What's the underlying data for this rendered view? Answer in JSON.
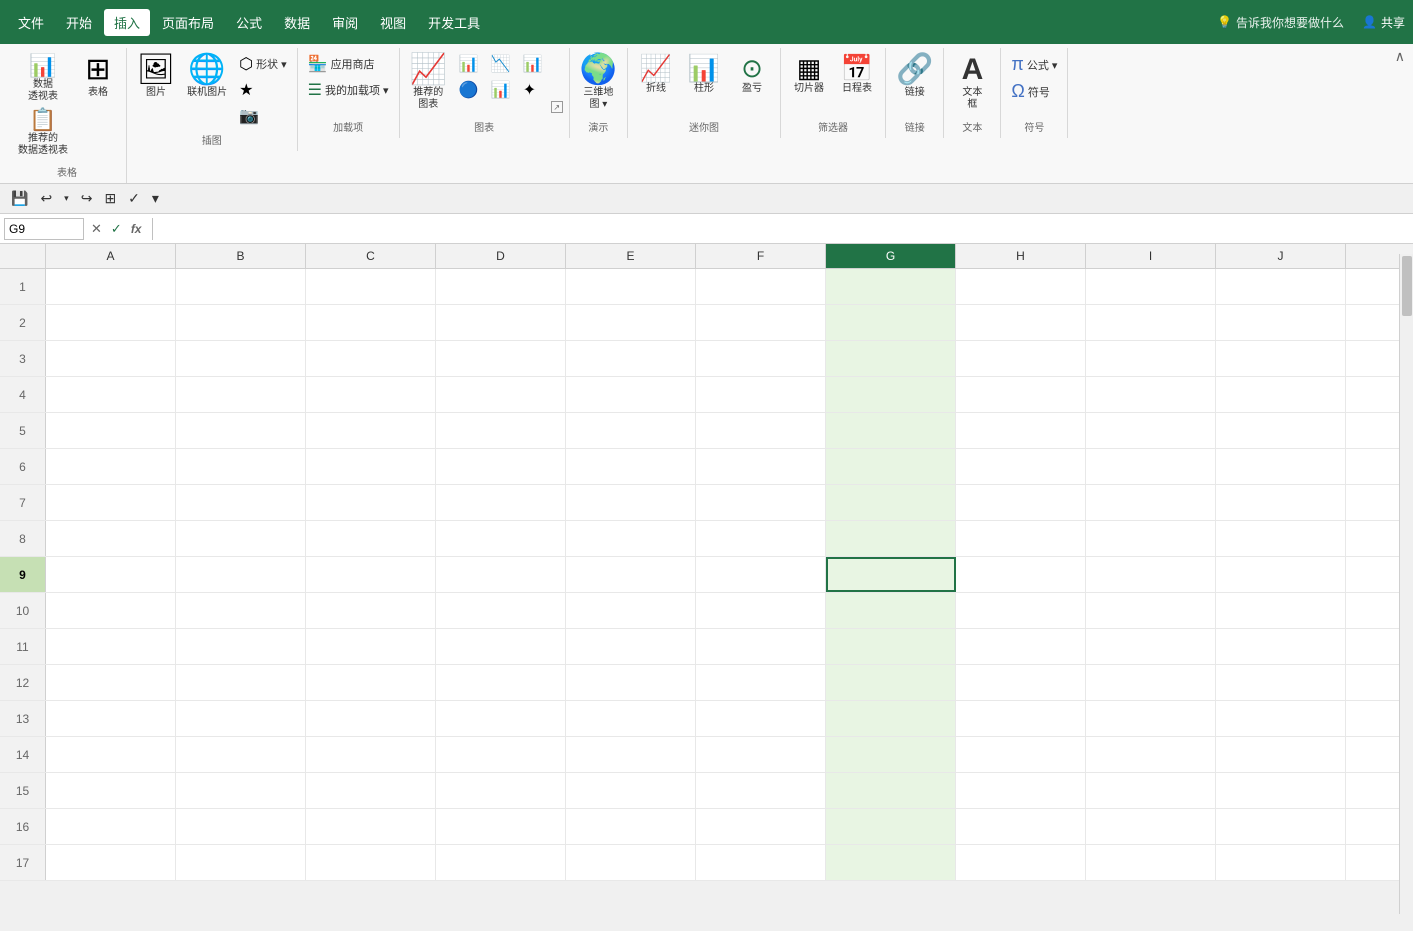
{
  "menu": {
    "items": [
      {
        "id": "file",
        "label": "文件"
      },
      {
        "id": "home",
        "label": "开始"
      },
      {
        "id": "insert",
        "label": "插入",
        "active": true
      },
      {
        "id": "page_layout",
        "label": "页面布局"
      },
      {
        "id": "formulas",
        "label": "公式"
      },
      {
        "id": "data",
        "label": "数据"
      },
      {
        "id": "review",
        "label": "审阅"
      },
      {
        "id": "view",
        "label": "视图"
      },
      {
        "id": "developer",
        "label": "开发工具"
      }
    ],
    "search_placeholder": "告诉我你想要做什么",
    "share_label": "♀ 共享"
  },
  "ribbon": {
    "groups": [
      {
        "id": "tables",
        "label": "表格",
        "buttons": [
          {
            "id": "pivot",
            "icon": "📊",
            "label": "数据\n透视表",
            "has_dropdown": true
          },
          {
            "id": "recommended_pivot",
            "icon": "📋",
            "label": "推荐的\n数据透视表"
          }
        ],
        "extra_btn": {
          "id": "table",
          "icon": "⊞",
          "label": "表格"
        }
      },
      {
        "id": "illustrations",
        "label": "插图",
        "buttons": [
          {
            "id": "pictures",
            "icon": "🖼",
            "label": "图片"
          },
          {
            "id": "online_pictures",
            "icon": "🌐",
            "label": "联机图片"
          }
        ],
        "small_buttons": [
          {
            "id": "shapes",
            "icon": "⬡",
            "label": "形状▾"
          },
          {
            "id": "icons_btn",
            "icon": "★",
            "label": ""
          },
          {
            "id": "screenshot",
            "icon": "📷",
            "label": ""
          }
        ]
      },
      {
        "id": "addins",
        "label": "加载项",
        "buttons": [
          {
            "id": "store",
            "icon": "🏪",
            "label": "应用商店"
          },
          {
            "id": "my_addins",
            "icon": "☰",
            "label": "我的加载项",
            "has_dropdown": true
          }
        ]
      },
      {
        "id": "charts",
        "label": "图表",
        "main_btn": {
          "id": "recommended_charts",
          "icon": "📈",
          "label": "推荐的\n图表"
        },
        "chart_rows": [
          [
            "📊",
            "📉",
            "📊"
          ],
          [
            "🔵",
            "📊",
            "✦"
          ]
        ],
        "expand": true
      },
      {
        "id": "tours",
        "label": "演示",
        "buttons": [
          {
            "id": "3d_map",
            "icon": "🌍",
            "label": "三维地\n图▾"
          }
        ]
      },
      {
        "id": "sparklines",
        "label": "迷你图",
        "buttons": [
          {
            "id": "line",
            "icon": "📈",
            "label": "折线"
          },
          {
            "id": "column",
            "icon": "📊",
            "label": "柱形"
          },
          {
            "id": "winloss",
            "icon": "⊙",
            "label": "盈亏"
          }
        ]
      },
      {
        "id": "filters",
        "label": "筛选器",
        "buttons": [
          {
            "id": "slicer",
            "icon": "▦",
            "label": "切片器"
          },
          {
            "id": "timeline",
            "icon": "📅",
            "label": "日程表"
          }
        ]
      },
      {
        "id": "links",
        "label": "链接",
        "buttons": [
          {
            "id": "hyperlink",
            "icon": "🔗",
            "label": "链接"
          }
        ]
      },
      {
        "id": "text_group",
        "label": "文本",
        "buttons": [
          {
            "id": "textbox",
            "icon": "A",
            "label": "文本\n框"
          }
        ]
      },
      {
        "id": "symbols",
        "label": "符号",
        "buttons": [
          {
            "id": "equation",
            "icon": "π",
            "label": "公式▾"
          },
          {
            "id": "symbol_btn",
            "icon": "Ω",
            "label": "符号"
          }
        ]
      }
    ]
  },
  "quick_toolbar": {
    "save_icon": "💾",
    "undo_icon": "↩",
    "redo_icon": "↪",
    "checkmark_icon": "✓"
  },
  "formula_bar": {
    "cell_ref": "G9",
    "cancel_icon": "✕",
    "confirm_icon": "✓",
    "func_icon": "fx"
  },
  "grid": {
    "columns": [
      "A",
      "B",
      "C",
      "D",
      "E",
      "F",
      "G",
      "H",
      "I",
      "J"
    ],
    "selected_col": "G",
    "active_cell": {
      "row": 9,
      "col": "G"
    },
    "rows": [
      1,
      2,
      3,
      4,
      5,
      6,
      7,
      8,
      9,
      10,
      11,
      12,
      13,
      14,
      15,
      16,
      17
    ]
  }
}
